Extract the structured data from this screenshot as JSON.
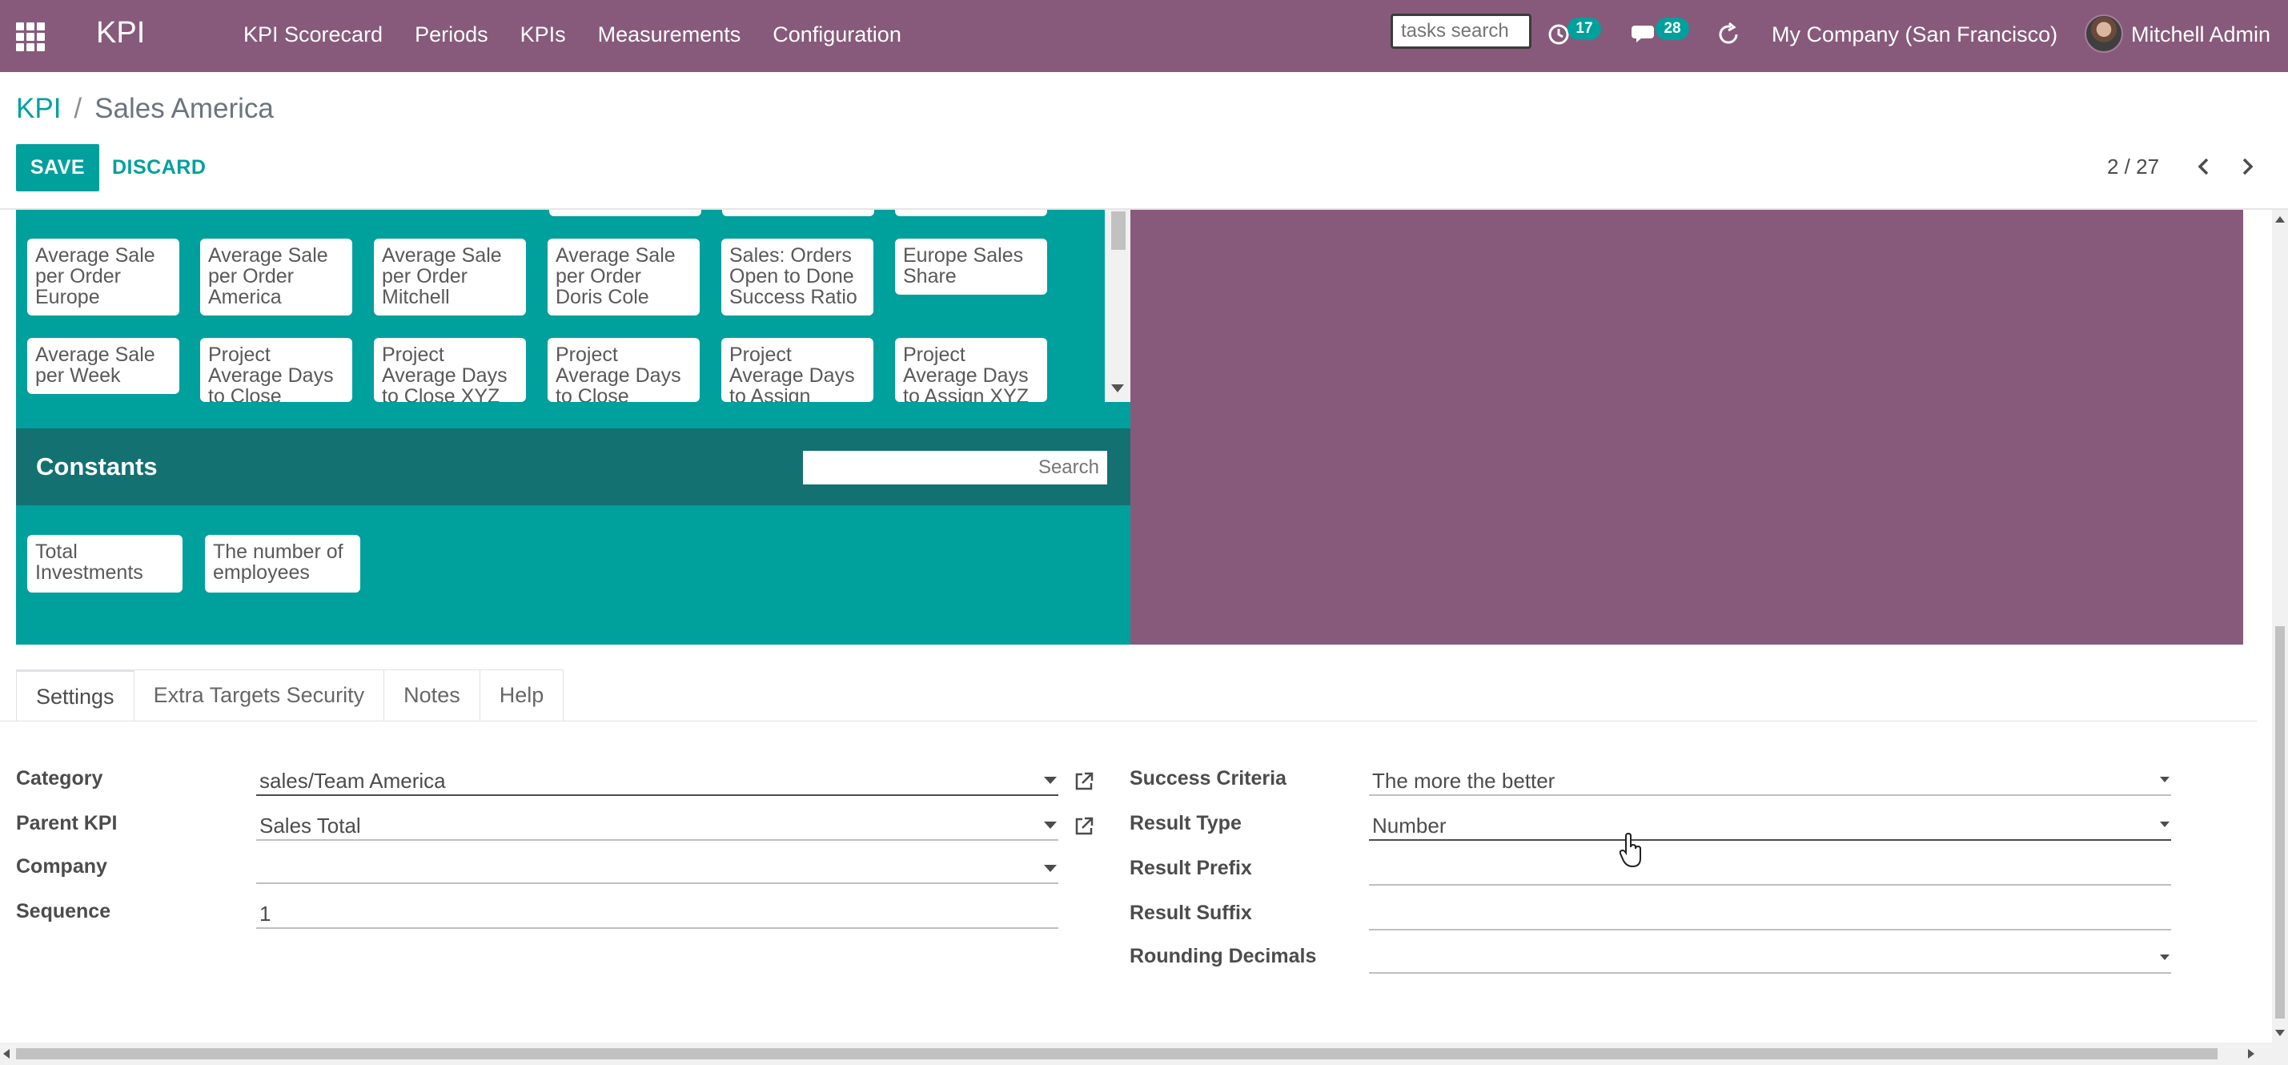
{
  "navbar": {
    "brand": "KPI",
    "menu": [
      "KPI Scorecard",
      "Periods",
      "KPIs",
      "Measurements",
      "Configuration"
    ],
    "tasks_search_placeholder": "tasks search",
    "activity_count": "17",
    "messages_count": "28",
    "company": "My Company (San Francisco)",
    "user": "Mitchell Admin",
    "bg_color": "#875a7b"
  },
  "control_panel": {
    "breadcrumb_root": "KPI",
    "breadcrumb_sep": "/",
    "breadcrumb_current": "Sales America",
    "save_label": "SAVE",
    "discard_label": "DISCARD",
    "pager": "2 / 27"
  },
  "formula": {
    "accent_color": "#00a09d",
    "kpis_row1": [
      "Average Sale per Order Europe",
      "Average Sale per Order America",
      "Average Sale per Order Mitchell",
      "Average Sale per Order Doris Cole",
      "Sales: Orders Open to Done Success Ratio",
      "Europe Sales Share"
    ],
    "kpis_row2": [
      "Average Sale per Week",
      "Project Average Days to Close",
      "Project Average Days to Close XYZ",
      "Project Average Days to Close",
      "Project Average Days to Assign",
      "Project Average Days to Assign XYZ"
    ],
    "constants_title": "Constants",
    "constants_search_placeholder": "Search",
    "constants": [
      "Total Investments",
      "The number of employees"
    ]
  },
  "tabs": [
    "Settings",
    "Extra Targets Security",
    "Notes",
    "Help"
  ],
  "settings": {
    "left": [
      {
        "label": "Category",
        "value": "sales/Team America"
      },
      {
        "label": "Parent KPI",
        "value": "Sales Total"
      },
      {
        "label": "Company",
        "value": ""
      },
      {
        "label": "Sequence",
        "value": "1"
      }
    ],
    "right": [
      {
        "label": "Success Criteria",
        "value": "The more the better"
      },
      {
        "label": "Result Type",
        "value": "Number"
      },
      {
        "label": "Result Prefix",
        "value": ""
      },
      {
        "label": "Result Suffix",
        "value": ""
      },
      {
        "label": "Rounding Decimals",
        "value": ""
      }
    ]
  }
}
